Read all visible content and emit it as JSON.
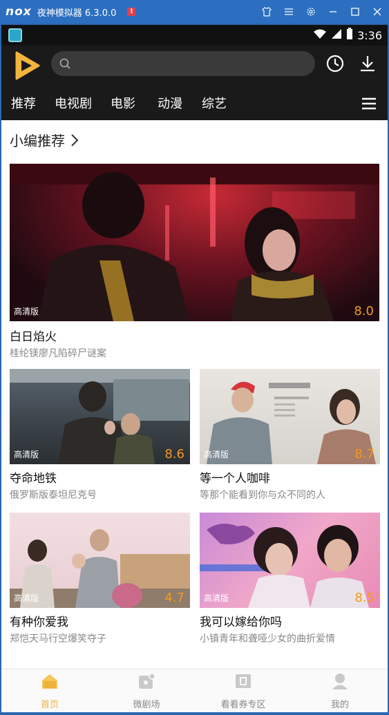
{
  "emulator": {
    "logo": "nox",
    "title": "夜神模拟器 6.3.0.0"
  },
  "statusbar": {
    "time": "3:36"
  },
  "search": {
    "placeholder": ""
  },
  "tabs": [
    "推荐",
    "电视剧",
    "电影",
    "动漫",
    "综艺"
  ],
  "section": {
    "title": "小编推荐"
  },
  "featured": {
    "title": "白日焰火",
    "subtitle": "桂纶镁廖凡陷碎尸谜案",
    "badge": "高清版",
    "score": "8.0"
  },
  "grid": [
    {
      "title": "夺命地铁",
      "subtitle": "俄罗斯版泰坦尼克号",
      "badge": "高清版",
      "score": "8.6"
    },
    {
      "title": "等一个人咖啡",
      "subtitle": "等那个能看到你与众不同的人",
      "badge": "高清版",
      "score": "8.7"
    },
    {
      "title": "有种你爱我",
      "subtitle": "郑恺天马行空爆笑夺子",
      "badge": "高清版",
      "score": "4.7"
    },
    {
      "title": "我可以嫁给你吗",
      "subtitle": "小镇青年和聋哑少女的曲折爱情",
      "badge": "高清版",
      "score": "8.5"
    }
  ],
  "bottomnav": [
    "首页",
    "微剧场",
    "看看券专区",
    "我的"
  ],
  "colors": {
    "accent": "#f0b23c",
    "score": "#f39a1e",
    "emulator": "#2c6fc0"
  }
}
